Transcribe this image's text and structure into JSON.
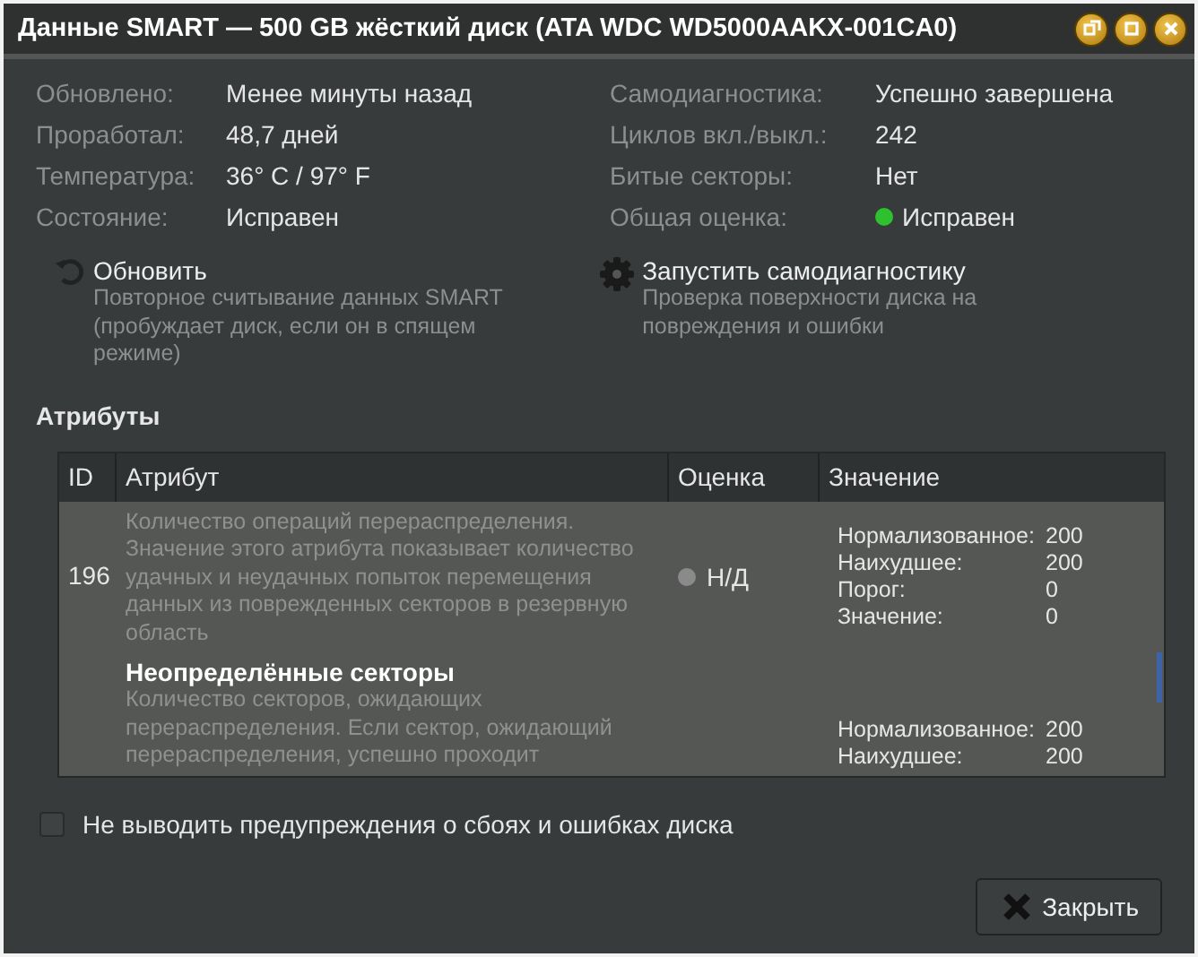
{
  "window": {
    "title": "Данные SMART — 500 GB жёсткий диск (ATA WDC WD5000AAKX-001CA0)"
  },
  "summary": {
    "left": [
      {
        "label": "Обновлено:",
        "value": "Менее минуты назад"
      },
      {
        "label": "Проработал:",
        "value": "48,7 дней"
      },
      {
        "label": "Температура:",
        "value": "36° C / 97° F"
      },
      {
        "label": "Состояние:",
        "value": "Исправен"
      }
    ],
    "right": [
      {
        "label": "Самодиагностика:",
        "value": "Успешно завершена"
      },
      {
        "label": "Циклов вкл./выкл.:",
        "value": "242"
      },
      {
        "label": "Битые секторы:",
        "value": "Нет"
      },
      {
        "label": "Общая оценка:",
        "value": "Исправен",
        "color": "#2ec02e"
      }
    ]
  },
  "actions": [
    {
      "kind": "refresh",
      "title": "Обновить",
      "description": "Повторное считывание данных SMART (пробуждает диск, если он в спящем режиме)"
    },
    {
      "kind": "selftest",
      "title": "Запустить самодиагностику",
      "description": "Проверка поверхности диска на повреждения и ошибки"
    }
  ],
  "attributes": {
    "heading": "Атрибуты",
    "columns": [
      "ID",
      "Атрибут",
      "Оценка",
      "Значение"
    ],
    "rows": [
      {
        "id": "196",
        "description": "Количество операций перераспределения. Значение этого атрибута показывает количество удачных и неудачных попыток перемещения данных из поврежденных секторов в резервную область",
        "rating": "Н/Д",
        "color": "#8a8a8a",
        "values": [
          {
            "label": "Нормализованное:",
            "value": "200"
          },
          {
            "label": "Наихудшее:",
            "value": "200"
          },
          {
            "label": "Порог:",
            "value": "0"
          },
          {
            "label": "Значение:",
            "value": "0"
          }
        ]
      },
      {
        "name": "Неопределённые секторы",
        "description": "Количество секторов, ожидающих перераспределения. Если сектор, ожидающий перераспределения, успешно проходит",
        "values": [
          {
            "label": "Нормализованное:",
            "value": "200"
          },
          {
            "label": "Наихудшее:",
            "value": "200"
          }
        ]
      }
    ]
  },
  "suppress_warnings": {
    "label": "Не выводить предупреждения о сбоях и ошибках диска",
    "checked": false
  },
  "buttons": [
    {
      "label": "Закрыть"
    }
  ]
}
